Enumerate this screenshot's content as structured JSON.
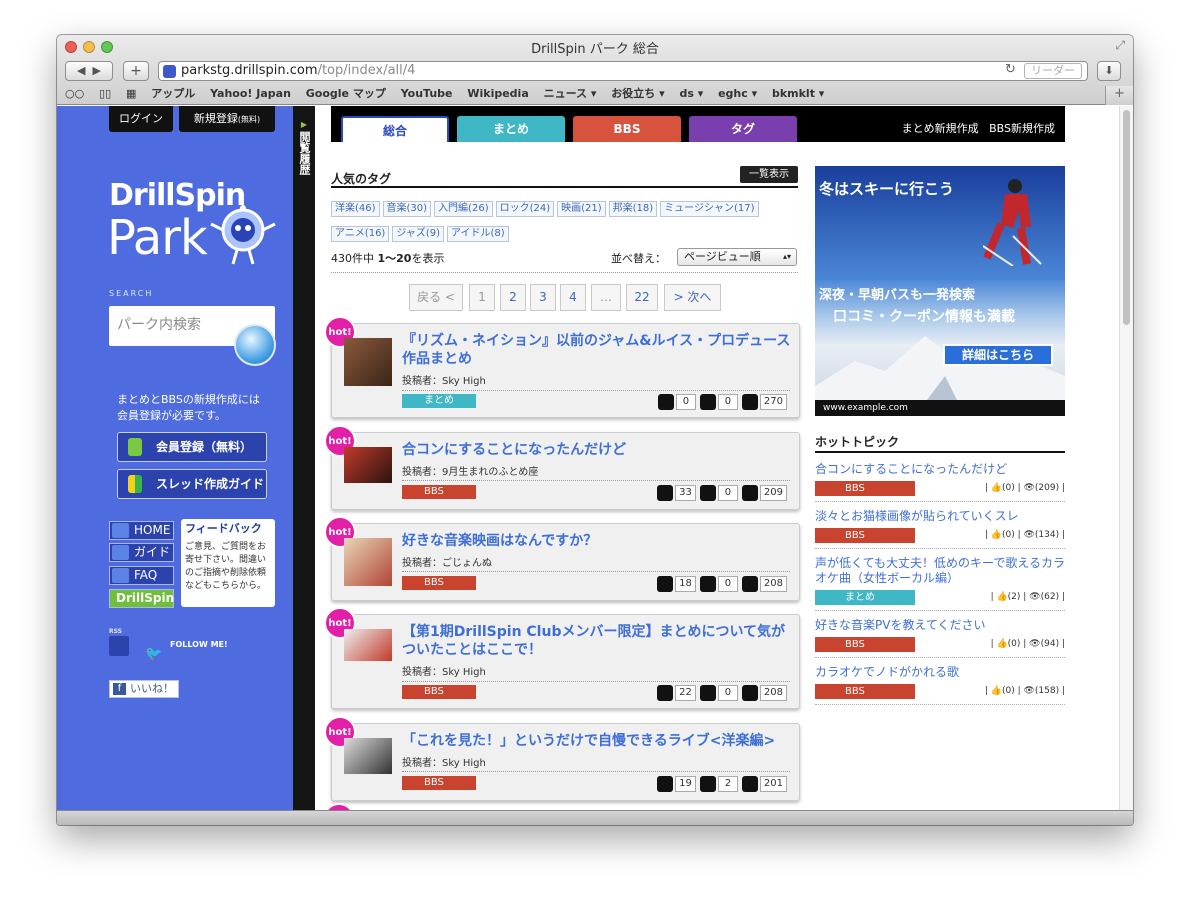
{
  "window": {
    "title": "DrillSpin パーク 総合"
  },
  "toolbar": {
    "reload": "↻",
    "reader": "リーダー",
    "new_tab": "+"
  },
  "url": {
    "host": "parkstg.drillspin.com",
    "path": "/top/index/all/4"
  },
  "bookmarks": [
    "アップル",
    "Yahoo! Japan",
    "Google マップ",
    "YouTube",
    "Wikipedia",
    "ニュース ▾",
    "お役立ち ▾",
    "ds ▾",
    "eghc ▾",
    "bkmklt ▾"
  ],
  "sidebar": {
    "login": "ログイン",
    "register": "新規登録",
    "register_small": "(無料)",
    "logo_top": "DrillSpin",
    "logo_bottom": "Park",
    "search_label": "SEARCH",
    "search_placeholder": "パーク内検索",
    "notice": "まとめとBBSの新規作成には会員登録が必要です。",
    "btn_register": "会員登録（無料）",
    "btn_thread_guide": "スレッド作成ガイド",
    "nav": [
      "HOME",
      "ガイド",
      "FAQ",
      "DrillSpin"
    ],
    "feedback_title": "フィードバック",
    "feedback_text": "ご意見、ご質問をお寄せ下さい。間違いのご指摘や削除依頼などもこちらから。",
    "rss": "RSS",
    "follow": "FOLLOW ME!",
    "like": "いいね！"
  },
  "history_bar": "閲覧履歴",
  "tabs": [
    {
      "label": "総合",
      "color": "#ffffff",
      "text": "#2b4bbd"
    },
    {
      "label": "まとめ",
      "color": "#3fb7c4",
      "text": "#ffffff"
    },
    {
      "label": "BBS",
      "color": "#d8533d",
      "text": "#ffffff"
    },
    {
      "label": "タグ",
      "color": "#7a3fae",
      "text": "#ffffff"
    }
  ],
  "top_links": [
    "まとめ新規作成",
    "BBS新規作成"
  ],
  "popular_tags": {
    "heading": "人気のタグ",
    "show_all": "一覧表示",
    "tags": [
      "洋楽(46)",
      "音楽(30)",
      "入門編(26)",
      "ロック(24)",
      "映画(21)",
      "邦楽(18)",
      "ミュージシャン(17)",
      "アニメ(16)",
      "ジャズ(9)",
      "アイドル(8)"
    ]
  },
  "result_count": {
    "prefix": "430件中",
    "range": "1〜20",
    "suffix": "を表示"
  },
  "sort": {
    "label": "並べ替え：",
    "value": "ページビュー順"
  },
  "pagination": [
    "戻る <",
    "1",
    "2",
    "3",
    "4",
    "…",
    "22",
    "> 次へ"
  ],
  "hot_label": "hot!",
  "posts": [
    {
      "title": "『リズム・ネイション』以前のジャム&ルイス・プロデュース作品まとめ",
      "author": "投稿者：Sky High",
      "type": "まとめ",
      "comments": "0",
      "likes": "0",
      "views": "270"
    },
    {
      "title": "合コンにすることになったんだけど",
      "author": "投稿者：9月生まれのふとめ座",
      "type": "BBS",
      "comments": "33",
      "likes": "0",
      "views": "209"
    },
    {
      "title": "好きな音楽映画はなんですか？",
      "author": "投稿者：ごじょんぬ",
      "type": "BBS",
      "comments": "18",
      "likes": "0",
      "views": "208"
    },
    {
      "title": "【第1期DrillSpin Clubメンバー限定】まとめについて気がついたことはここで！",
      "author": "投稿者：Sky High",
      "type": "BBS",
      "comments": "22",
      "likes": "0",
      "views": "208"
    },
    {
      "title": "「これを見た！」というだけで自慢できるライブ<洋楽編>",
      "author": "投稿者：Sky High",
      "type": "BBS",
      "comments": "19",
      "likes": "2",
      "views": "201"
    }
  ],
  "ad": {
    "line1": "冬はスキーに行こう",
    "line2": "深夜・早朝バスも一発検索",
    "line3": "口コミ・クーポン情報も満載",
    "button": "詳細はこちら",
    "url": "www.example.com"
  },
  "hot_topics": {
    "heading": "ホットトピック",
    "items": [
      {
        "title": "合コンにすることになったんだけど",
        "type": "BBS",
        "likes": "(0)",
        "views": "(209)"
      },
      {
        "title": "淡々とお猫様画像が貼られていくスレ",
        "type": "BBS",
        "likes": "(0)",
        "views": "(134)"
      },
      {
        "title": "声が低くても大丈夫！低めのキーで歌えるカラオケ曲（女性ボーカル編）",
        "type": "まとめ",
        "likes": "(2)",
        "views": "(62)"
      },
      {
        "title": "好きな音楽PVを教えてください",
        "type": "BBS",
        "likes": "(0)",
        "views": "(94)"
      },
      {
        "title": "カラオケでノドがかれる歌",
        "type": "BBS",
        "likes": "(0)",
        "views": "(158)"
      }
    ]
  },
  "colors": {
    "sidebar": "#4e6be0",
    "link": "#3e6fd8",
    "bbs": "#c8442f",
    "matome": "#3fb7c4",
    "hot": "#e31fa8"
  }
}
